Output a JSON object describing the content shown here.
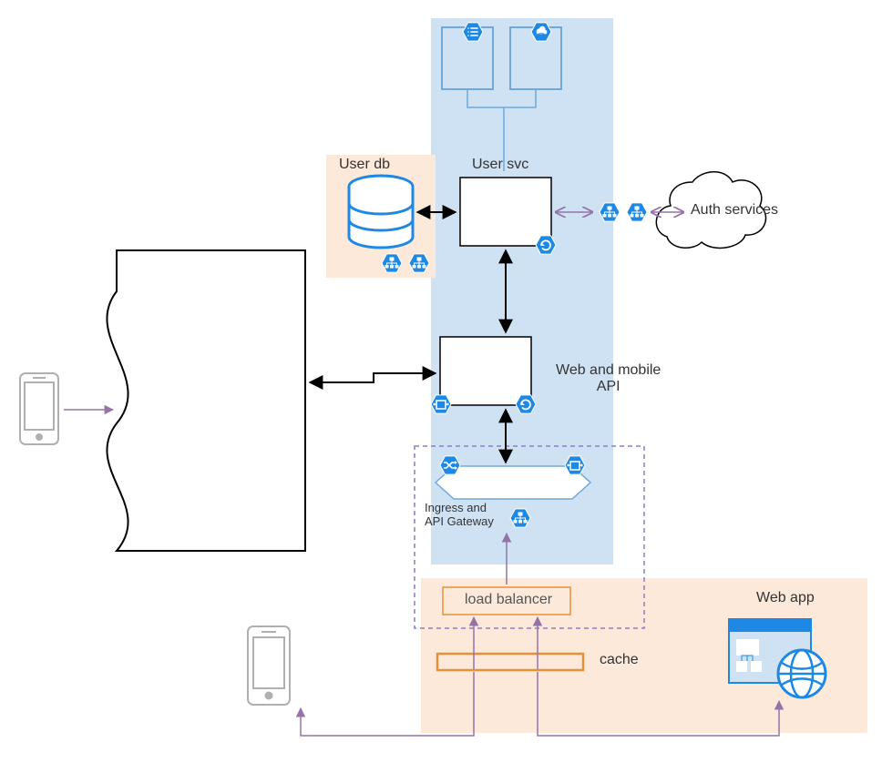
{
  "nodes": {
    "user_db": {
      "label": "User db"
    },
    "user_svc": {
      "label": "User svc"
    },
    "auth_services": {
      "label": "Auth services"
    },
    "web_mobile_api": {
      "label": "Web and mobile\nAPI"
    },
    "ingress_api_gateway": {
      "label": "Ingress and\nAPI Gateway"
    },
    "load_balancer": {
      "label": "load balancer"
    },
    "cache": {
      "label": "cache"
    },
    "web_app": {
      "label": "Web app"
    }
  },
  "colors": {
    "blue_region": "#cfe2f3",
    "blue_icon": "#1e88e5",
    "peach_region": "#fde9d9",
    "orange_border": "#e69138",
    "purple_dash": "#8e7cc3",
    "arrow_purple": "#9673a6",
    "arrow_black": "#000000",
    "cloud_outline": "#000000",
    "grey_outline": "#b0b0b0",
    "text": "#333333"
  },
  "icons": [
    "list-icon",
    "cloud-db-icon",
    "org-chart-icon",
    "refresh-icon",
    "package-icon",
    "shuffle-icon",
    "globe-icon",
    "database-icon"
  ]
}
